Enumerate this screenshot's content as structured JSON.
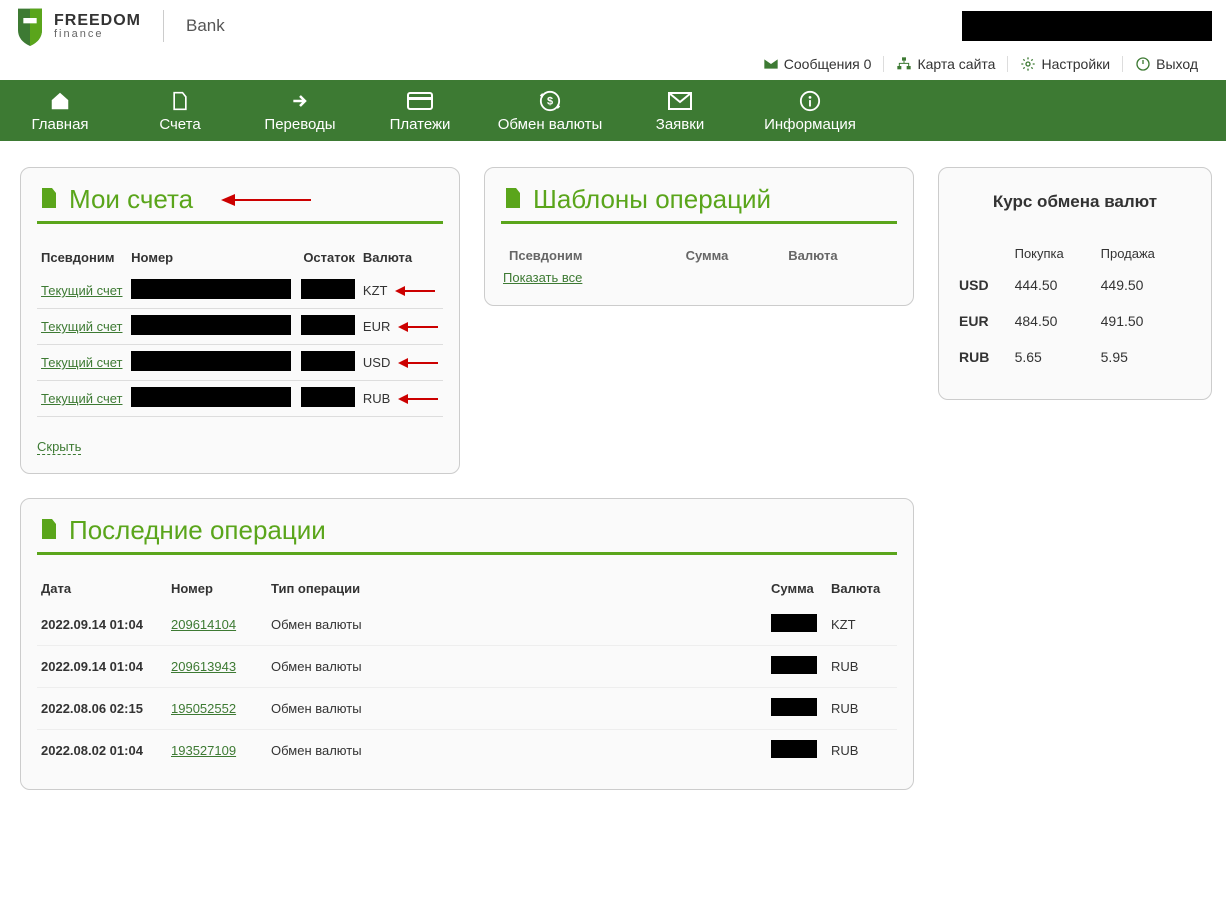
{
  "brand": {
    "line1": "FREEDOM",
    "line2": "finance",
    "bank": "Bank"
  },
  "toplinks": {
    "messages": "Сообщения 0",
    "sitemap": "Карта сайта",
    "settings": "Настройки",
    "logout": "Выход"
  },
  "nav": {
    "home": "Главная",
    "accounts": "Счета",
    "transfers": "Переводы",
    "payments": "Платежи",
    "exchange": "Обмен валюты",
    "requests": "Заявки",
    "info": "Информация"
  },
  "accounts": {
    "title": "Мои счета",
    "columns": {
      "alias": "Псевдоним",
      "number": "Номер",
      "balance": "Остаток",
      "currency": "Валюта"
    },
    "rows": [
      {
        "alias": "Текущий счет",
        "currency": "KZT"
      },
      {
        "alias": "Текущий счет",
        "currency": "EUR"
      },
      {
        "alias": "Текущий счет",
        "currency": "USD"
      },
      {
        "alias": "Текущий счет",
        "currency": "RUB"
      }
    ],
    "hide": "Скрыть"
  },
  "templates": {
    "title": "Шаблоны операций",
    "columns": {
      "alias": "Псевдоним",
      "amount": "Сумма",
      "currency": "Валюта"
    },
    "showall": "Показать все"
  },
  "rates": {
    "title": "Курс обмена валют",
    "columns": {
      "buy": "Покупка",
      "sell": "Продажа"
    },
    "rows": [
      {
        "code": "USD",
        "buy": "444.50",
        "sell": "449.50"
      },
      {
        "code": "EUR",
        "buy": "484.50",
        "sell": "491.50"
      },
      {
        "code": "RUB",
        "buy": "5.65",
        "sell": "5.95"
      }
    ]
  },
  "ops": {
    "title": "Последние операции",
    "columns": {
      "date": "Дата",
      "number": "Номер",
      "type": "Тип операции",
      "amount": "Сумма",
      "currency": "Валюта"
    },
    "rows": [
      {
        "date": "2022.09.14 01:04",
        "number": "209614104",
        "type": "Обмен валюты",
        "currency": "KZT"
      },
      {
        "date": "2022.09.14 01:04",
        "number": "209613943",
        "type": "Обмен валюты",
        "currency": "RUB"
      },
      {
        "date": "2022.08.06 02:15",
        "number": "195052552",
        "type": "Обмен валюты",
        "currency": "RUB"
      },
      {
        "date": "2022.08.02 01:04",
        "number": "193527109",
        "type": "Обмен валюты",
        "currency": "RUB"
      }
    ]
  }
}
